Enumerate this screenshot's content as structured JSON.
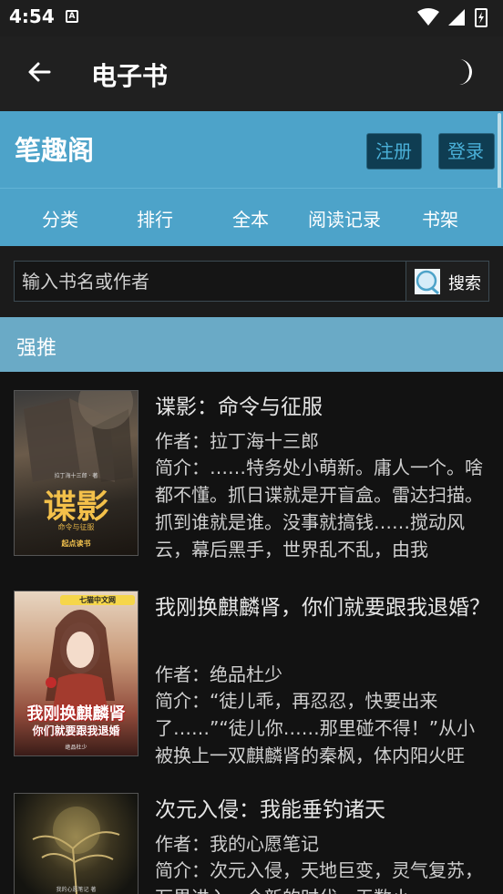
{
  "status": {
    "time": "4:54",
    "a_badge": "A"
  },
  "app_bar": {
    "title": "电子书",
    "back_icon": "arrow-back-icon",
    "theme_icon": "moon-icon"
  },
  "site": {
    "title": "笔趣阁",
    "register_label": "注册",
    "login_label": "登录"
  },
  "nav": [
    "分类",
    "排行",
    "全本",
    "阅读记录",
    "书架"
  ],
  "search": {
    "placeholder": "输入书名或作者",
    "button_label": "搜索",
    "value": ""
  },
  "section": {
    "title": "强推"
  },
  "books": [
    {
      "title": "谍影：命令与征服",
      "author": "作者：拉丁海十三郎",
      "desc": "简介：……特务处小萌新。庸人一个。啥都不懂。抓日谍就是开盲盒。雷达扫描。抓到谁就是谁。没事就搞钱……搅动风云，幕后黑手，世界乱不乱，由我",
      "cover_title": "谍影",
      "cover_sub": "命令与征服",
      "cover_author": "拉丁海十三郎 · 著",
      "cover_publisher": "起点读书"
    },
    {
      "title": "我刚换麒麟肾，你们就要跟我退婚？",
      "author": "作者：绝品杜少",
      "desc": "简介：“徒儿乖，再忍忍，快要出来了……”“徒儿你……那里碰不得！”从小被换上一双麒麟肾的秦枫，体内阳火旺",
      "cover_title": "我刚换麒麟肾",
      "cover_sub": "你们就要跟我退婚",
      "cover_publisher": "七猫中文网",
      "cover_author": "绝品杜少"
    },
    {
      "title": "次元入侵：我能垂钓诸天",
      "author": "作者：我的心愿笔记",
      "desc": "简介：次元入侵，天地巨变，灵气复苏，万界进入一个新的时代，无数小",
      "cover_author": "我的心愿笔记 著"
    }
  ]
}
